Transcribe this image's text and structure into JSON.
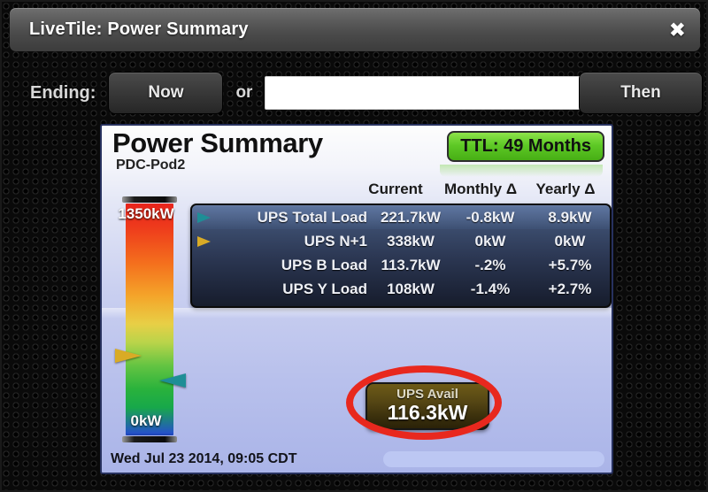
{
  "window": {
    "title": "LiveTile: Power Summary",
    "close_icon": "close-icon",
    "close_glyph": "✖"
  },
  "toolbar": {
    "ending_label": "Ending:",
    "now_button": "Now",
    "or_label": "or",
    "then_button": "Then",
    "date_input_value": "",
    "date_input_placeholder": ""
  },
  "tile": {
    "title": "Power Summary",
    "subtitle": "PDC-Pod2",
    "ttl_badge": "TTL: 49 Months",
    "timestamp": "Wed Jul 23 2014, 09:05 CDT",
    "columns": [
      "Current",
      "Monthly Δ",
      "Yearly Δ"
    ],
    "rows": [
      {
        "marker": "teal-arrow-right-icon",
        "marker_color": "#1e8e96",
        "label": "UPS Total Load",
        "current": "221.7kW",
        "monthly": "-0.8kW",
        "yearly": "8.9kW",
        "highlighted": true
      },
      {
        "marker": "gold-arrow-right-icon",
        "marker_color": "#d9ab26",
        "label": "UPS N+1",
        "current": "338kW",
        "monthly": "0kW",
        "yearly": "0kW",
        "highlighted": false
      },
      {
        "marker": "none",
        "marker_color": "",
        "label": "UPS B Load",
        "current": "113.7kW",
        "monthly": "-.2%",
        "yearly": "+5.7%",
        "highlighted": false
      },
      {
        "marker": "none",
        "marker_color": "",
        "label": "UPS Y Load",
        "current": "108kW",
        "monthly": "-1.4%",
        "yearly": "+2.7%",
        "highlighted": false
      }
    ],
    "gauge": {
      "max_label": "1350kW",
      "min_label": "0kW",
      "markers": [
        {
          "name": "ups-n-plus-1-marker",
          "value_kw": 338,
          "color": "#d9ab26",
          "side": "left"
        },
        {
          "name": "ups-total-load-marker",
          "value_kw": 221.7,
          "color": "#1e8e96",
          "side": "right"
        }
      ]
    },
    "availability": {
      "label": "UPS Avail",
      "value": "116.3kW",
      "annotation": "red-ellipse-highlight"
    }
  },
  "colors": {
    "accent_green": "#5ec926",
    "annotation_red": "#e8281e",
    "tile_background": "#c9cff0",
    "panel_dark": "#2a3550"
  }
}
